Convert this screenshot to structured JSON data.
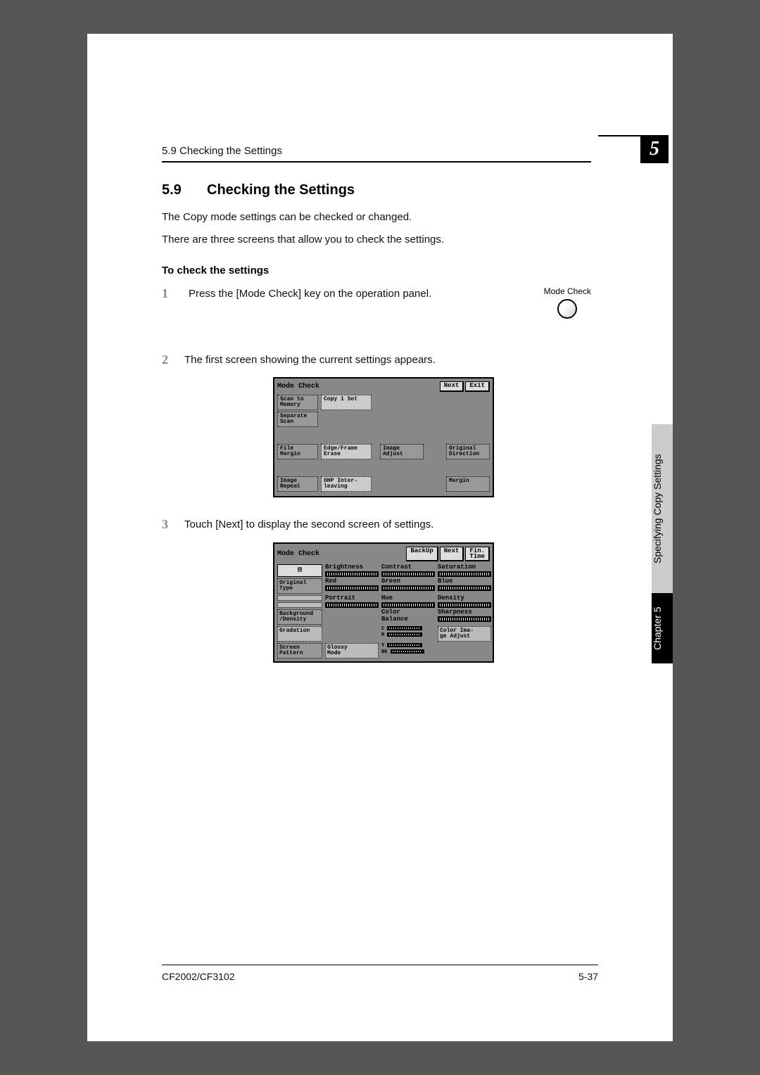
{
  "chapter_box": "5",
  "running_head": "5.9 Checking the Settings",
  "heading_number": "5.9",
  "heading_text": "Checking the Settings",
  "intro_p1": "The Copy mode settings can be checked or changed.",
  "intro_p2": "There are three screens that allow you to check the settings.",
  "subhead": "To check the settings",
  "step1_num": "1",
  "step1_text": "Press the [Mode Check] key on the operation panel.",
  "mode_check_label": "Mode Check",
  "step2_num": "2",
  "step2_text": "The first screen showing the current settings appears.",
  "step3_num": "3",
  "step3_text": "Touch [Next] to display the second screen of settings.",
  "screen1": {
    "title": "Mode Check",
    "buttons": {
      "next": "Next",
      "exit": "Exit"
    },
    "scan_to_memory": "Scan to\nMemory",
    "copy_1_set": "Copy 1 Set",
    "separate_scan": "Separate\nScan",
    "file_margin": "File\nMargin",
    "edge_frame_erase": "Edge/Frame\nErase",
    "image_adjust": "Image\nAdjust",
    "original_direction": "Original\nDirection",
    "image_repeat": "Image\nRepeat",
    "ohp_interleaving": "OHP Inter-\nleaving",
    "margin": "Margin"
  },
  "screen2": {
    "title": "Mode Check",
    "buttons": {
      "backup": "BackUp",
      "next": "Next",
      "fin_time": "Fin.\nTime"
    },
    "original_type": "Original\nType",
    "background_density": "Background\n/Density",
    "gradation": "Gradation",
    "screen_pattern": "Screen\nPattern",
    "glossy_mode": "Glossy\nMode",
    "brightness": "Brightness",
    "red": "Red",
    "portrait": "Portrait",
    "contrast": "Contrast",
    "green": "Green",
    "hue": "Hue",
    "color_balance": "Color\nBalance",
    "cb_c": "C",
    "cb_m": "M",
    "cb_y": "Y",
    "cb_bk": "BK",
    "saturation": "Saturation",
    "blue": "Blue",
    "density": "Density",
    "sharpness": "Sharpness",
    "color_image_adjust": "Color Ima-\nge Adjust"
  },
  "side_tab_dark": "Chapter 5",
  "side_tab_light": "Specifying Copy Settings",
  "footer_left": "CF2002/CF3102",
  "footer_right": "5-37"
}
